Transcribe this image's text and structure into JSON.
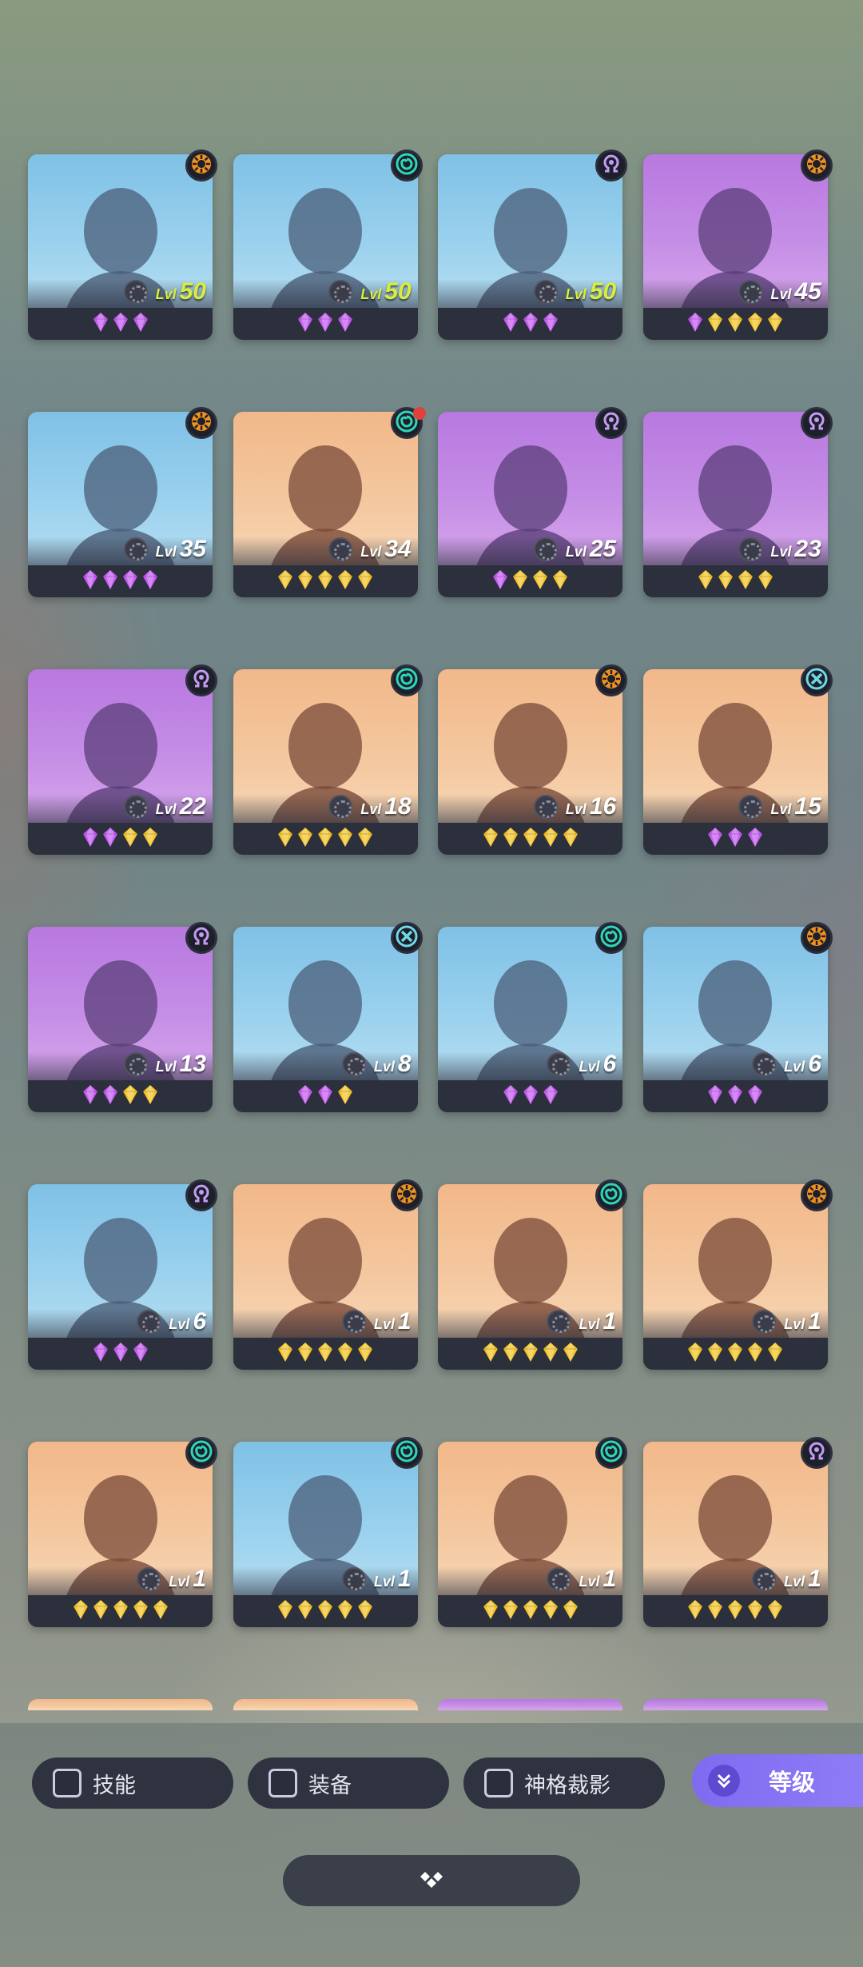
{
  "colors": {
    "level_max": "#d9ee3c",
    "strip": "#2c2f3c",
    "gem_purple": "#c55cf0",
    "gem_gold": "#f3c52c",
    "accent_sort": "#7f6bf0",
    "class_orange": "#f0931e",
    "class_teal": "#2ed6b8",
    "class_purple": "#c49cf2",
    "class_cyan": "#6fd8e6"
  },
  "level_label": "Lvl",
  "heroes": [
    {
      "bg": "blue",
      "class_icon": "sun-icon",
      "level": "50",
      "max": true,
      "gems": [
        "purple",
        "purple",
        "purple"
      ]
    },
    {
      "bg": "blue",
      "class_icon": "swirl-icon",
      "level": "50",
      "max": true,
      "gems": [
        "purple",
        "purple",
        "purple"
      ]
    },
    {
      "bg": "blue",
      "class_icon": "omega-icon",
      "level": "50",
      "max": true,
      "gems": [
        "purple",
        "purple",
        "purple"
      ]
    },
    {
      "bg": "purple",
      "class_icon": "sun-icon",
      "level": "45",
      "max": false,
      "gems": [
        "purple",
        "gold",
        "gold",
        "gold",
        "gold"
      ]
    },
    {
      "bg": "blue",
      "class_icon": "sun-icon",
      "level": "35",
      "max": false,
      "gems": [
        "purple",
        "purple",
        "purple",
        "purple"
      ]
    },
    {
      "bg": "peach",
      "class_icon": "swirl-icon",
      "level": "34",
      "max": false,
      "gems": [
        "gold",
        "gold",
        "gold",
        "gold",
        "gold"
      ],
      "notification": true
    },
    {
      "bg": "purple",
      "class_icon": "omega-icon",
      "level": "25",
      "max": false,
      "gems": [
        "purple",
        "gold",
        "gold",
        "gold"
      ]
    },
    {
      "bg": "purple",
      "class_icon": "omega-icon",
      "level": "23",
      "max": false,
      "gems": [
        "gold",
        "gold",
        "gold",
        "gold"
      ]
    },
    {
      "bg": "purple",
      "class_icon": "omega-icon",
      "level": "22",
      "max": false,
      "gems": [
        "purple",
        "purple",
        "gold",
        "gold"
      ]
    },
    {
      "bg": "peach",
      "class_icon": "swirl-icon",
      "level": "18",
      "max": false,
      "gems": [
        "gold",
        "gold",
        "gold",
        "gold",
        "gold"
      ]
    },
    {
      "bg": "peach",
      "class_icon": "sun-icon",
      "level": "16",
      "max": false,
      "gems": [
        "gold",
        "gold",
        "gold",
        "gold",
        "gold"
      ]
    },
    {
      "bg": "peach",
      "class_icon": "cross-icon",
      "level": "15",
      "max": false,
      "gems": [
        "purple",
        "purple",
        "purple"
      ]
    },
    {
      "bg": "purple",
      "class_icon": "omega-icon",
      "level": "13",
      "max": false,
      "gems": [
        "purple",
        "purple",
        "gold",
        "gold"
      ]
    },
    {
      "bg": "blue",
      "class_icon": "cross-icon",
      "level": "8",
      "max": false,
      "gems": [
        "purple",
        "purple",
        "gold"
      ]
    },
    {
      "bg": "blue",
      "class_icon": "swirl-icon",
      "level": "6",
      "max": false,
      "gems": [
        "purple",
        "purple",
        "purple"
      ]
    },
    {
      "bg": "blue",
      "class_icon": "sun-icon",
      "level": "6",
      "max": false,
      "gems": [
        "purple",
        "purple",
        "purple"
      ]
    },
    {
      "bg": "blue",
      "class_icon": "omega-icon",
      "level": "6",
      "max": false,
      "gems": [
        "purple",
        "purple",
        "purple"
      ]
    },
    {
      "bg": "peach",
      "class_icon": "sun-icon",
      "level": "1",
      "max": false,
      "gems": [
        "gold",
        "gold",
        "gold",
        "gold",
        "gold"
      ]
    },
    {
      "bg": "peach",
      "class_icon": "swirl-icon",
      "level": "1",
      "max": false,
      "gems": [
        "gold",
        "gold",
        "gold",
        "gold",
        "gold"
      ]
    },
    {
      "bg": "peach",
      "class_icon": "sun-icon",
      "level": "1",
      "max": false,
      "gems": [
        "gold",
        "gold",
        "gold",
        "gold",
        "gold"
      ]
    },
    {
      "bg": "peach",
      "class_icon": "swirl-icon",
      "level": "1",
      "max": false,
      "gems": [
        "gold",
        "gold",
        "gold",
        "gold",
        "gold"
      ]
    },
    {
      "bg": "blue",
      "class_icon": "swirl-icon",
      "level": "1",
      "max": false,
      "gems": [
        "gold",
        "gold",
        "gold",
        "gold",
        "gold"
      ]
    },
    {
      "bg": "peach",
      "class_icon": "swirl-icon",
      "level": "1",
      "max": false,
      "gems": [
        "gold",
        "gold",
        "gold",
        "gold",
        "gold"
      ]
    },
    {
      "bg": "peach",
      "class_icon": "omega-icon",
      "level": "1",
      "max": false,
      "gems": [
        "gold",
        "gold",
        "gold",
        "gold",
        "gold"
      ]
    }
  ],
  "filters": {
    "skill": "技能",
    "equipment": "装备",
    "divine": "神格裁影"
  },
  "sort": {
    "label": "等级"
  }
}
